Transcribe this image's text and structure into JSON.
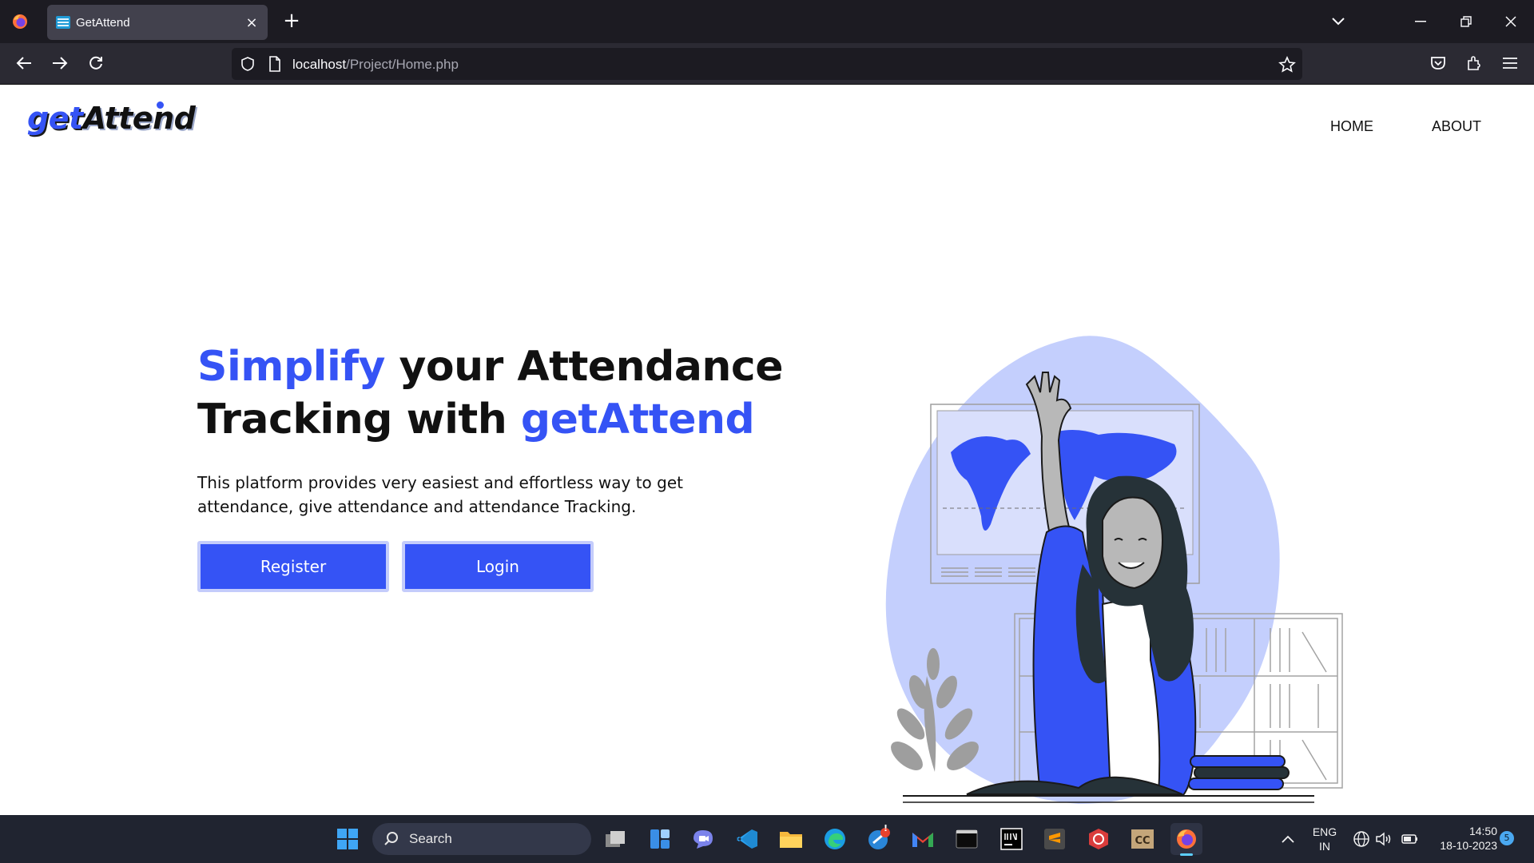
{
  "browser": {
    "tab_title": "GetAttend",
    "tab_close": "×",
    "new_tab": "+",
    "url_host": "localhost",
    "url_path": "/Project/Home.php"
  },
  "site": {
    "logo_get": "get",
    "logo_attend": "Attend",
    "nav": {
      "home": "HOME",
      "about": "ABOUT"
    },
    "hero": {
      "title_1": "Simplify",
      "title_2": " your Attendance Tracking with ",
      "title_3": "getAttend",
      "description": "This platform provides very easiest and effortless way to get attendance, give attendance and attendance Tracking.",
      "register_label": "Register",
      "login_label": "Login"
    },
    "colors": {
      "accent": "#3553f5",
      "accent_light": "#c4ccfb"
    }
  },
  "taskbar": {
    "search_label": "Search",
    "language_1": "ENG",
    "language_2": "IN",
    "time": "14:50",
    "date": "18-10-2023",
    "notification_count": "5",
    "alert_badge": "!"
  }
}
